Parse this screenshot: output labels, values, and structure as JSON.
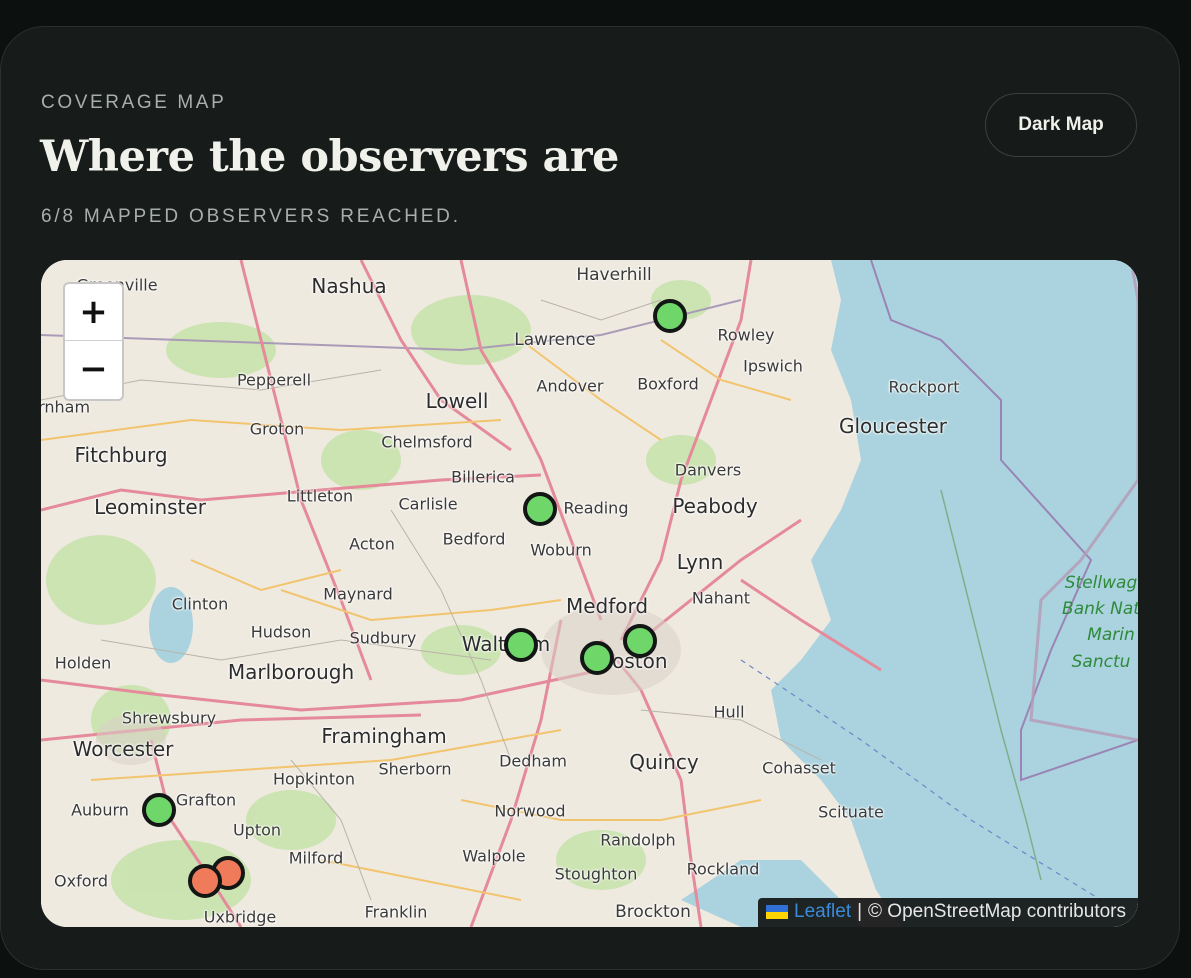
{
  "header": {
    "eyebrow": "COVERAGE MAP",
    "title": "Where the observers are",
    "status": "6/8 MAPPED OBSERVERS REACHED."
  },
  "map_toggle": {
    "label": "Dark Map"
  },
  "zoom": {
    "in_label": "+",
    "out_label": "−"
  },
  "attribution": {
    "leaflet": "Leaflet",
    "separator": "|",
    "text": "© OpenStreetMap contributors"
  },
  "places": {
    "haverhill": "Haverhill",
    "nashua": "Nashua",
    "greenville": "Greenville",
    "lawrence": "Lawrence",
    "rowley": "Rowley",
    "ipswich": "Ipswich",
    "pepperell": "Pepperell",
    "andover": "Andover",
    "boxford": "Boxford",
    "rockport": "Rockport",
    "burnham": "urnham",
    "lowell": "Lowell",
    "gloucester": "Gloucester",
    "groton": "Groton",
    "chelmsford": "Chelmsford",
    "fitchburg": "Fitchburg",
    "billerica": "Billerica",
    "danvers": "Danvers",
    "littleton": "Littleton",
    "leominster": "Leominster",
    "carlisle": "Carlisle",
    "reading": "Reading",
    "peabody": "Peabody",
    "bedford": "Bedford",
    "acton": "Acton",
    "woburn": "Woburn",
    "lynn": "Lynn",
    "maynard": "Maynard",
    "nahant": "Nahant",
    "clinton": "Clinton",
    "medford": "Medford",
    "hudson": "Hudson",
    "sudbury": "Sudbury",
    "waltham": "Waltham",
    "holden": "Holden",
    "boston": "Boston",
    "marlborough": "Marlborough",
    "hull": "Hull",
    "shrewsbury": "Shrewsbury",
    "framingham": "Framingham",
    "worcester": "Worcester",
    "dedham": "Dedham",
    "quincy": "Quincy",
    "cohasset": "Cohasset",
    "hopkinton": "Hopkinton",
    "sherborn": "Sherborn",
    "auburn": "Auburn",
    "grafton": "Grafton",
    "norwood": "Norwood",
    "scituate": "Scituate",
    "upton": "Upton",
    "randolph": "Randolph",
    "milford": "Milford",
    "walpole": "Walpole",
    "rockland": "Rockland",
    "oxford": "Oxford",
    "stoughton": "Stoughton",
    "uxbridge": "Uxbridge",
    "franklin": "Franklin",
    "brockton": "Brockton",
    "stellwagen": [
      "Stellwag",
      "Bank Nat",
      "Marin",
      "Sanctu"
    ]
  },
  "markers": [
    {
      "status": "reached",
      "color": "#6fd66a"
    },
    {
      "status": "reached",
      "color": "#6fd66a"
    },
    {
      "status": "reached",
      "color": "#6fd66a"
    },
    {
      "status": "reached",
      "color": "#6fd66a"
    },
    {
      "status": "reached",
      "color": "#6fd66a"
    },
    {
      "status": "reached",
      "color": "#6fd66a"
    },
    {
      "status": "not_reached",
      "color": "#ef7b5a"
    },
    {
      "status": "not_reached",
      "color": "#ef7b5a"
    }
  ],
  "colors": {
    "water": "#aad3df",
    "land": "#efeae0",
    "forest": "#c8e2ad",
    "major_road": "#e58a9a",
    "minor_road": "#f2c46e",
    "boundary": "#9a84b5"
  }
}
